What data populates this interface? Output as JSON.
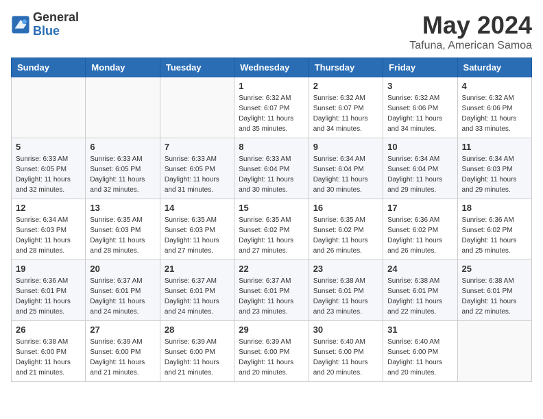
{
  "logo": {
    "general": "General",
    "blue": "Blue"
  },
  "header": {
    "title": "May 2024",
    "subtitle": "Tafuna, American Samoa"
  },
  "weekdays": [
    "Sunday",
    "Monday",
    "Tuesday",
    "Wednesday",
    "Thursday",
    "Friday",
    "Saturday"
  ],
  "weeks": [
    [
      {
        "day": "",
        "info": ""
      },
      {
        "day": "",
        "info": ""
      },
      {
        "day": "",
        "info": ""
      },
      {
        "day": "1",
        "info": "Sunrise: 6:32 AM\nSunset: 6:07 PM\nDaylight: 11 hours\nand 35 minutes."
      },
      {
        "day": "2",
        "info": "Sunrise: 6:32 AM\nSunset: 6:07 PM\nDaylight: 11 hours\nand 34 minutes."
      },
      {
        "day": "3",
        "info": "Sunrise: 6:32 AM\nSunset: 6:06 PM\nDaylight: 11 hours\nand 34 minutes."
      },
      {
        "day": "4",
        "info": "Sunrise: 6:32 AM\nSunset: 6:06 PM\nDaylight: 11 hours\nand 33 minutes."
      }
    ],
    [
      {
        "day": "5",
        "info": "Sunrise: 6:33 AM\nSunset: 6:05 PM\nDaylight: 11 hours\nand 32 minutes."
      },
      {
        "day": "6",
        "info": "Sunrise: 6:33 AM\nSunset: 6:05 PM\nDaylight: 11 hours\nand 32 minutes."
      },
      {
        "day": "7",
        "info": "Sunrise: 6:33 AM\nSunset: 6:05 PM\nDaylight: 11 hours\nand 31 minutes."
      },
      {
        "day": "8",
        "info": "Sunrise: 6:33 AM\nSunset: 6:04 PM\nDaylight: 11 hours\nand 30 minutes."
      },
      {
        "day": "9",
        "info": "Sunrise: 6:34 AM\nSunset: 6:04 PM\nDaylight: 11 hours\nand 30 minutes."
      },
      {
        "day": "10",
        "info": "Sunrise: 6:34 AM\nSunset: 6:04 PM\nDaylight: 11 hours\nand 29 minutes."
      },
      {
        "day": "11",
        "info": "Sunrise: 6:34 AM\nSunset: 6:03 PM\nDaylight: 11 hours\nand 29 minutes."
      }
    ],
    [
      {
        "day": "12",
        "info": "Sunrise: 6:34 AM\nSunset: 6:03 PM\nDaylight: 11 hours\nand 28 minutes."
      },
      {
        "day": "13",
        "info": "Sunrise: 6:35 AM\nSunset: 6:03 PM\nDaylight: 11 hours\nand 28 minutes."
      },
      {
        "day": "14",
        "info": "Sunrise: 6:35 AM\nSunset: 6:03 PM\nDaylight: 11 hours\nand 27 minutes."
      },
      {
        "day": "15",
        "info": "Sunrise: 6:35 AM\nSunset: 6:02 PM\nDaylight: 11 hours\nand 27 minutes."
      },
      {
        "day": "16",
        "info": "Sunrise: 6:35 AM\nSunset: 6:02 PM\nDaylight: 11 hours\nand 26 minutes."
      },
      {
        "day": "17",
        "info": "Sunrise: 6:36 AM\nSunset: 6:02 PM\nDaylight: 11 hours\nand 26 minutes."
      },
      {
        "day": "18",
        "info": "Sunrise: 6:36 AM\nSunset: 6:02 PM\nDaylight: 11 hours\nand 25 minutes."
      }
    ],
    [
      {
        "day": "19",
        "info": "Sunrise: 6:36 AM\nSunset: 6:01 PM\nDaylight: 11 hours\nand 25 minutes."
      },
      {
        "day": "20",
        "info": "Sunrise: 6:37 AM\nSunset: 6:01 PM\nDaylight: 11 hours\nand 24 minutes."
      },
      {
        "day": "21",
        "info": "Sunrise: 6:37 AM\nSunset: 6:01 PM\nDaylight: 11 hours\nand 24 minutes."
      },
      {
        "day": "22",
        "info": "Sunrise: 6:37 AM\nSunset: 6:01 PM\nDaylight: 11 hours\nand 23 minutes."
      },
      {
        "day": "23",
        "info": "Sunrise: 6:38 AM\nSunset: 6:01 PM\nDaylight: 11 hours\nand 23 minutes."
      },
      {
        "day": "24",
        "info": "Sunrise: 6:38 AM\nSunset: 6:01 PM\nDaylight: 11 hours\nand 22 minutes."
      },
      {
        "day": "25",
        "info": "Sunrise: 6:38 AM\nSunset: 6:01 PM\nDaylight: 11 hours\nand 22 minutes."
      }
    ],
    [
      {
        "day": "26",
        "info": "Sunrise: 6:38 AM\nSunset: 6:00 PM\nDaylight: 11 hours\nand 21 minutes."
      },
      {
        "day": "27",
        "info": "Sunrise: 6:39 AM\nSunset: 6:00 PM\nDaylight: 11 hours\nand 21 minutes."
      },
      {
        "day": "28",
        "info": "Sunrise: 6:39 AM\nSunset: 6:00 PM\nDaylight: 11 hours\nand 21 minutes."
      },
      {
        "day": "29",
        "info": "Sunrise: 6:39 AM\nSunset: 6:00 PM\nDaylight: 11 hours\nand 20 minutes."
      },
      {
        "day": "30",
        "info": "Sunrise: 6:40 AM\nSunset: 6:00 PM\nDaylight: 11 hours\nand 20 minutes."
      },
      {
        "day": "31",
        "info": "Sunrise: 6:40 AM\nSunset: 6:00 PM\nDaylight: 11 hours\nand 20 minutes."
      },
      {
        "day": "",
        "info": ""
      }
    ]
  ]
}
